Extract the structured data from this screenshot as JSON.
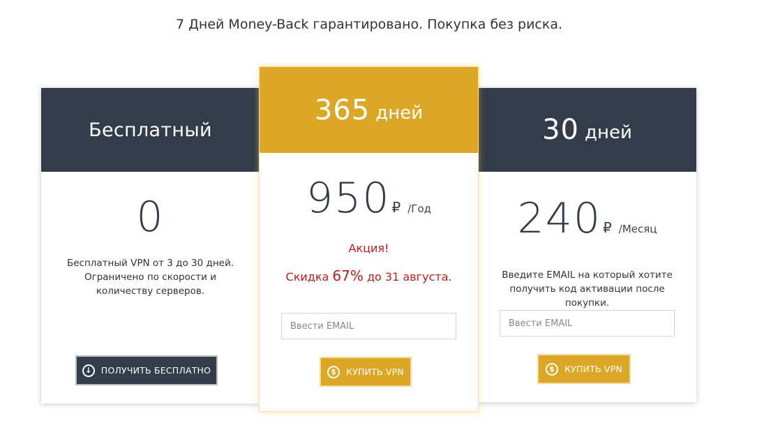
{
  "tagline": "7 Дней Money-Back гарантировано. Покупка без риска.",
  "colors": {
    "dark_header": "#333c4a",
    "gold_header": "#dba725",
    "promo_red": "#c41c1c"
  },
  "plans": {
    "free": {
      "title": "Бесплатный",
      "price": "0",
      "description": "Бесплатный VPN от 3 до 30 дней. Ограничено по скорости и количеству серверов.",
      "button_label": "ПОЛУЧИТЬ БЕСПЛАТНО",
      "button_icon": "download-circle-icon"
    },
    "year": {
      "title_number": "365",
      "title_unit": "дней",
      "price": "950",
      "currency": "₽",
      "period": "/Год",
      "promo_title": "Акция!",
      "promo_prefix": "Скидка",
      "promo_percent": "67%",
      "promo_suffix": "до 31 августа.",
      "email_placeholder": "Ввести EMAIL",
      "button_label": "КУПИТЬ VPN",
      "button_icon": "dollar-circle-icon"
    },
    "month": {
      "title_number": "30",
      "title_unit": "дней",
      "price": "240",
      "currency": "₽",
      "period": "/Месяц",
      "description": "Введите EMAIL на который хотите получить код активации после покупки.",
      "email_placeholder": "Ввести EMAIL",
      "button_label": "КУПИТЬ VPN",
      "button_icon": "dollar-circle-icon"
    }
  }
}
